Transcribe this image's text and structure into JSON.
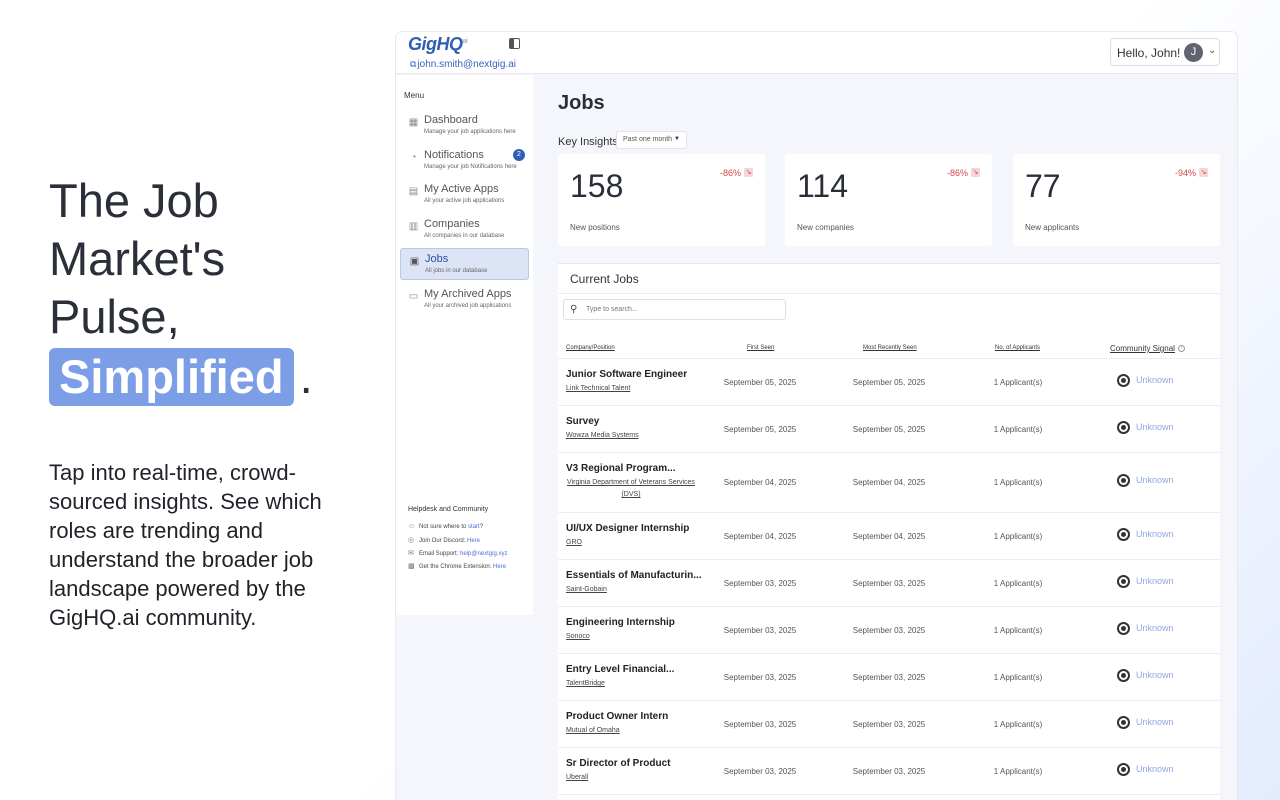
{
  "hero": {
    "line1": "The Job",
    "line2": "Market's",
    "line3": "Pulse,",
    "highlight": "Simplified",
    "dot": ".",
    "subtitle": "Tap into real-time, crowd-sourced insights. See which roles are trending and understand the broader job landscape powered by the GigHQ.ai community."
  },
  "header": {
    "logo": "GigHQ",
    "logo_sub": "ai",
    "email": "john.smith@nextgig.ai",
    "greeting": "Hello, John!",
    "avatar_initial": "J"
  },
  "sidebar": {
    "menu_label": "Menu",
    "items": [
      {
        "label": "Dashboard",
        "desc": "Manage your job applications here",
        "icon": "grid-icon"
      },
      {
        "label": "Notifications",
        "desc": "Manage your job Notifications here",
        "icon": "bell-icon",
        "badge": "2"
      },
      {
        "label": "My Active Apps",
        "desc": "All your active job applications",
        "icon": "document-icon"
      },
      {
        "label": "Companies",
        "desc": "All companies in our database",
        "icon": "building-icon"
      },
      {
        "label": "Jobs",
        "desc": "All jobs in our database",
        "icon": "briefcase-icon",
        "active": true
      },
      {
        "label": "My Archived Apps",
        "desc": "All your archived job applications",
        "icon": "folder-icon"
      }
    ],
    "help": {
      "title": "Helpdesk and Community",
      "start_text": "Not sure where to ",
      "start_link": "start",
      "start_suffix": "?",
      "discord_text": "Join Our Discord: ",
      "discord_link": "Here",
      "email_text": "Email Support: ",
      "email_link": "help@nextgig.xyz",
      "chrome_text": "Get the Chrome Extension: ",
      "chrome_link": "Here"
    }
  },
  "main": {
    "page_title": "Jobs",
    "insights_label": "Key Insights",
    "period": "Past one month",
    "cards": [
      {
        "value": "158",
        "label": "New positions",
        "change": "-86%"
      },
      {
        "value": "114",
        "label": "New companies",
        "change": "-86%"
      },
      {
        "value": "77",
        "label": "New applicants",
        "change": "-94%"
      }
    ],
    "jobs_title": "Current Jobs",
    "search_placeholder": "Type to search...",
    "columns": {
      "company": "Company/Position",
      "first_seen": "First Seen",
      "recent": "Most Recently Seen",
      "applicants": "No. of Applicants",
      "signal": "Community Signal"
    },
    "rows": [
      {
        "title": "Junior Software Engineer",
        "company": "Link Technical Talent",
        "first": "September 05, 2025",
        "recent": "September 05, 2025",
        "applicants": "1 Applicant(s)",
        "signal": "Unknown"
      },
      {
        "title": "Survey",
        "company": "Wowza Media Systems",
        "first": "September 05, 2025",
        "recent": "September 05, 2025",
        "applicants": "1 Applicant(s)",
        "signal": "Unknown"
      },
      {
        "title": "V3 Regional Program...",
        "company": "Virginia Department of Veterans Services (DVS)",
        "first": "September 04, 2025",
        "recent": "September 04, 2025",
        "applicants": "1 Applicant(s)",
        "signal": "Unknown"
      },
      {
        "title": "UI/UX Designer Internship",
        "company": "GRO",
        "first": "September 04, 2025",
        "recent": "September 04, 2025",
        "applicants": "1 Applicant(s)",
        "signal": "Unknown"
      },
      {
        "title": "Essentials of Manufacturin...",
        "company": "Saint-Gobain",
        "first": "September 03, 2025",
        "recent": "September 03, 2025",
        "applicants": "1 Applicant(s)",
        "signal": "Unknown"
      },
      {
        "title": "Engineering Internship",
        "company": "Sonoco",
        "first": "September 03, 2025",
        "recent": "September 03, 2025",
        "applicants": "1 Applicant(s)",
        "signal": "Unknown"
      },
      {
        "title": "Entry Level Financial...",
        "company": "TalentBridge",
        "first": "September 03, 2025",
        "recent": "September 03, 2025",
        "applicants": "1 Applicant(s)",
        "signal": "Unknown"
      },
      {
        "title": "Product Owner Intern",
        "company": "Mutual of Omaha",
        "first": "September 03, 2025",
        "recent": "September 03, 2025",
        "applicants": "1 Applicant(s)",
        "signal": "Unknown"
      },
      {
        "title": "Sr Director of Product",
        "company": "Uberall",
        "first": "September 03, 2025",
        "recent": "September 03, 2025",
        "applicants": "1 Applicant(s)",
        "signal": "Unknown"
      }
    ]
  }
}
